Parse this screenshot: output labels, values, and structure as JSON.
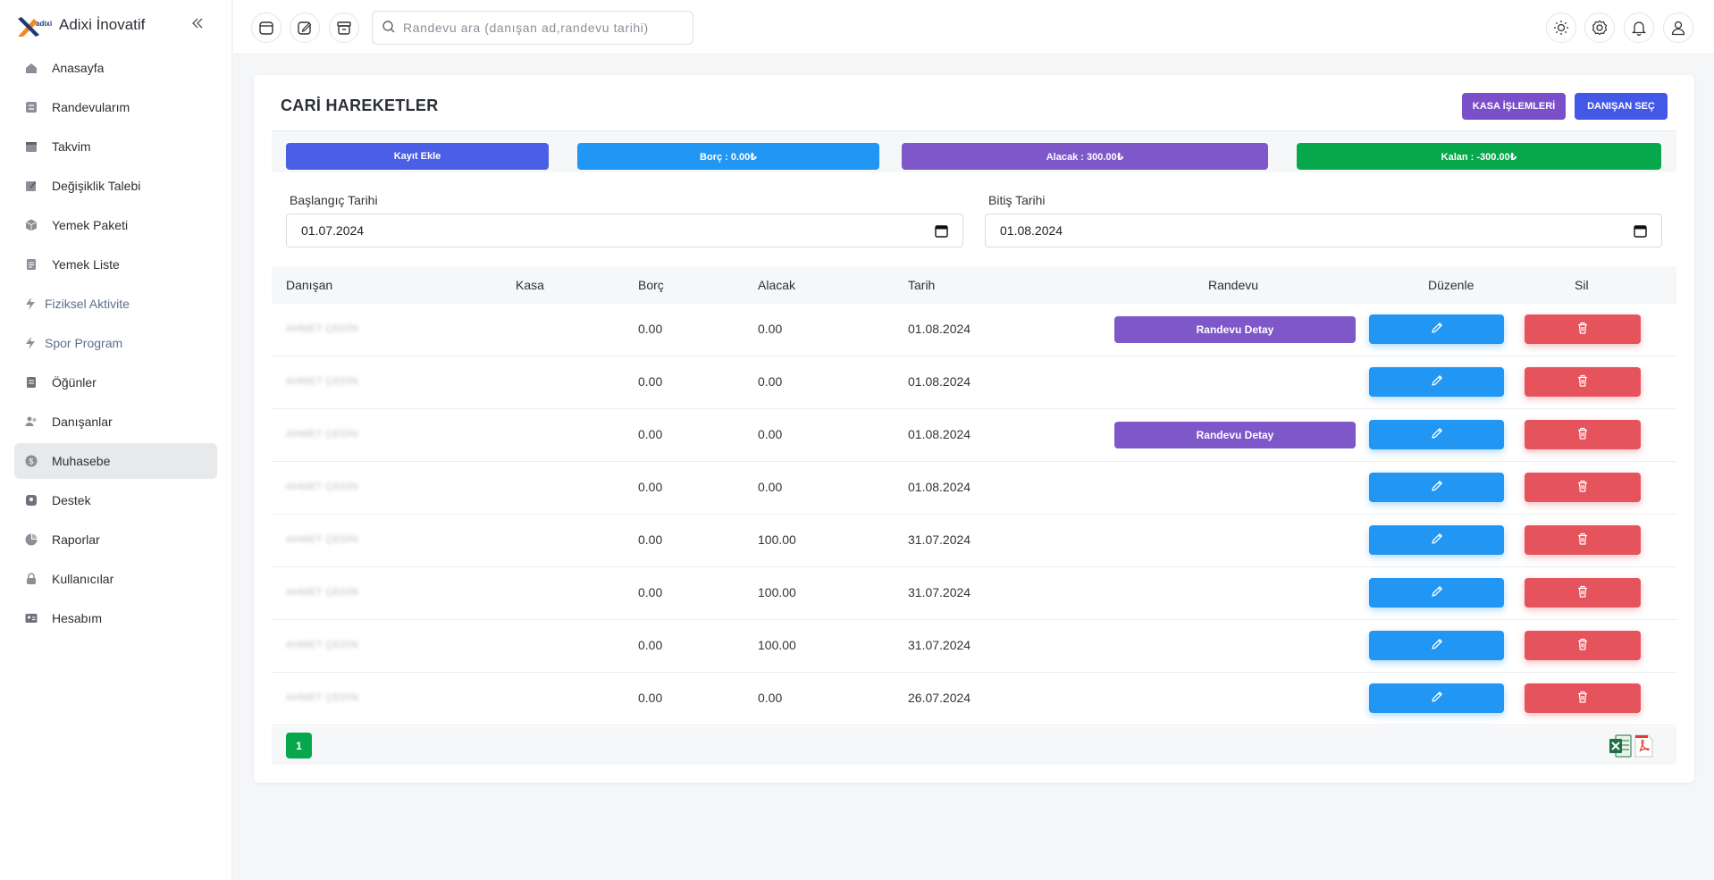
{
  "app": {
    "brand": "Adixi İnovatif",
    "logo_text": "adixi"
  },
  "sidebar": {
    "items": [
      {
        "label": "Anasayfa",
        "icon": "home-icon"
      },
      {
        "label": "Randevularım",
        "icon": "appointment-icon"
      },
      {
        "label": "Takvim",
        "icon": "calendar-icon"
      },
      {
        "label": "Değişiklik Talebi",
        "icon": "edit-request-icon"
      },
      {
        "label": "Yemek Paketi",
        "icon": "package-icon"
      },
      {
        "label": "Yemek Liste",
        "icon": "list-icon"
      },
      {
        "label": "Fiziksel Aktivite",
        "icon": "lightning-icon"
      },
      {
        "label": "Spor Program",
        "icon": "lightning-icon"
      },
      {
        "label": "Öğünler",
        "icon": "meals-icon"
      },
      {
        "label": "Danışanlar",
        "icon": "users-icon"
      },
      {
        "label": "Muhasebe",
        "icon": "dollar-icon",
        "active": true
      },
      {
        "label": "Destek",
        "icon": "support-icon"
      },
      {
        "label": "Raporlar",
        "icon": "pie-chart-icon"
      },
      {
        "label": "Kullanıcılar",
        "icon": "lock-icon"
      },
      {
        "label": "Hesabım",
        "icon": "id-card-icon"
      }
    ]
  },
  "topbar": {
    "search_placeholder": "Randevu ara (danışan ad,randevu tarihi)"
  },
  "page": {
    "title": "CARİ HAREKETLER",
    "kasa_button": "KASA İŞLEMLERİ",
    "danisan_button": "DANIŞAN SEÇ",
    "summary": {
      "kayit_ekle": "Kayıt Ekle",
      "borc": "Borç : 0.00₺",
      "alacak": "Alacak : 300.00₺",
      "kalan": "Kalan : -300.00₺"
    },
    "filters": {
      "start_label": "Başlangıç Tarihi",
      "start_value": "01.07.2024",
      "end_label": "Bitiş Tarihi",
      "end_value": "01.08.2024"
    }
  },
  "table": {
    "headers": {
      "danisan": "Danışan",
      "kasa": "Kasa",
      "borc": "Borç",
      "alacak": "Alacak",
      "tarih": "Tarih",
      "randevu": "Randevu",
      "duzenle": "Düzenle",
      "sil": "Sil"
    },
    "randevu_detay_label": "Randevu Detay",
    "rows": [
      {
        "danisan": "AHMET ÇEDİN",
        "kasa": "",
        "borc": "0.00",
        "alacak": "0.00",
        "tarih": "01.08.2024",
        "has_randevu": true
      },
      {
        "danisan": "AHMET ÇEDİN",
        "kasa": "",
        "borc": "0.00",
        "alacak": "0.00",
        "tarih": "01.08.2024",
        "has_randevu": false
      },
      {
        "danisan": "AHMET ÇEDİN",
        "kasa": "",
        "borc": "0.00",
        "alacak": "0.00",
        "tarih": "01.08.2024",
        "has_randevu": true
      },
      {
        "danisan": "AHMET ÇEDİN",
        "kasa": "",
        "borc": "0.00",
        "alacak": "0.00",
        "tarih": "01.08.2024",
        "has_randevu": false
      },
      {
        "danisan": "AHMET ÇEDİN",
        "kasa": "",
        "borc": "0.00",
        "alacak": "100.00",
        "tarih": "31.07.2024",
        "has_randevu": false
      },
      {
        "danisan": "AHMET ÇEDİN",
        "kasa": "",
        "borc": "0.00",
        "alacak": "100.00",
        "tarih": "31.07.2024",
        "has_randevu": false
      },
      {
        "danisan": "AHMET ÇEDİN",
        "kasa": "",
        "borc": "0.00",
        "alacak": "100.00",
        "tarih": "31.07.2024",
        "has_randevu": false
      },
      {
        "danisan": "AHMET ÇEDİN",
        "kasa": "",
        "borc": "0.00",
        "alacak": "0.00",
        "tarih": "26.07.2024",
        "has_randevu": false
      }
    ]
  },
  "pagination": {
    "current": "1"
  },
  "colors": {
    "primary": "#4a5fe6",
    "info": "#2196f3",
    "purple": "#7e57c8",
    "success": "#07a84c",
    "danger": "#e5535d"
  }
}
